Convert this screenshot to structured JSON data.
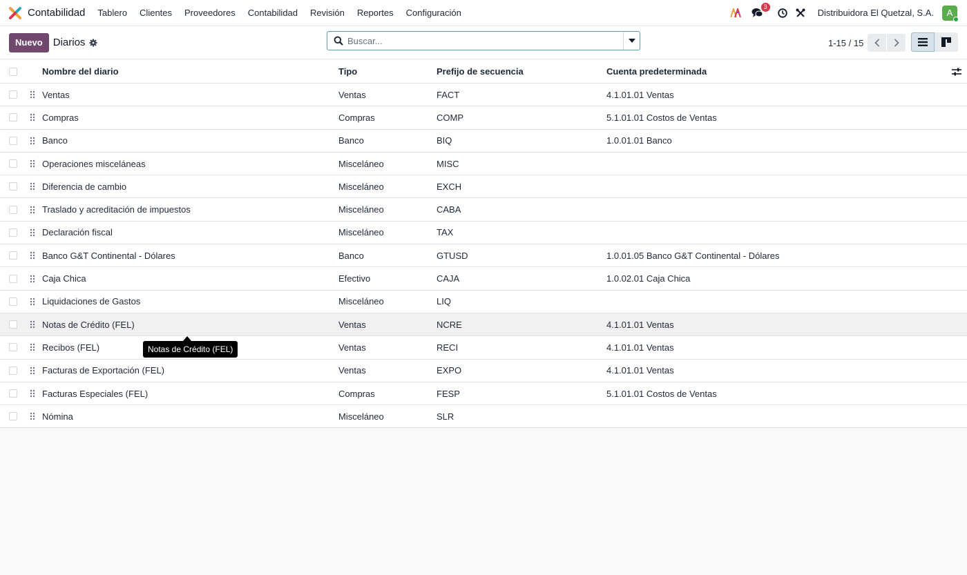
{
  "navbar": {
    "app_name": "Contabilidad",
    "menu": [
      "Tablero",
      "Clientes",
      "Proveedores",
      "Contabilidad",
      "Revisión",
      "Reportes",
      "Configuración"
    ],
    "messages_count": "3",
    "company": "Distribuidora El Quetzal, S.A.",
    "avatar_letter": "A",
    "icons": [
      "app-logo-icon",
      "ai-icon",
      "chat-icon",
      "clock-icon",
      "tools-icon"
    ]
  },
  "control_panel": {
    "new_label": "Nuevo",
    "title": "Diarios",
    "search_placeholder": "Buscar...",
    "pager": "1-15 / 15"
  },
  "table": {
    "columns": [
      "Nombre del diario",
      "Tipo",
      "Prefijo de secuencia",
      "Cuenta predeterminada"
    ],
    "rows": [
      {
        "name": "Ventas",
        "type": "Ventas",
        "prefix": "FACT",
        "account": "4.1.01.01 Ventas"
      },
      {
        "name": "Compras",
        "type": "Compras",
        "prefix": "COMP",
        "account": "5.1.01.01 Costos de Ventas"
      },
      {
        "name": "Banco",
        "type": "Banco",
        "prefix": "BIQ",
        "account": "1.0.01.01 Banco"
      },
      {
        "name": "Operaciones misceláneas",
        "type": "Misceláneo",
        "prefix": "MISC",
        "account": ""
      },
      {
        "name": "Diferencia de cambio",
        "type": "Misceláneo",
        "prefix": "EXCH",
        "account": ""
      },
      {
        "name": "Traslado y acreditación de impuestos",
        "type": "Misceláneo",
        "prefix": "CABA",
        "account": ""
      },
      {
        "name": "Declaración fiscal",
        "type": "Misceláneo",
        "prefix": "TAX",
        "account": ""
      },
      {
        "name": "Banco G&T Continental - Dólares",
        "type": "Banco",
        "prefix": "GTUSD",
        "account": "1.0.01.05 Banco G&T Continental - Dólares"
      },
      {
        "name": "Caja Chica",
        "type": "Efectivo",
        "prefix": "CAJA",
        "account": "1.0.02.01 Caja Chica"
      },
      {
        "name": "Liquidaciones de Gastos",
        "type": "Misceláneo",
        "prefix": "LIQ",
        "account": ""
      },
      {
        "name": "Notas de Crédito (FEL)",
        "type": "Ventas",
        "prefix": "NCRE",
        "account": "4.1.01.01 Ventas"
      },
      {
        "name": "Recibos (FEL)",
        "type": "Ventas",
        "prefix": "RECI",
        "account": "4.1.01.01 Ventas"
      },
      {
        "name": "Facturas de Exportación (FEL)",
        "type": "Ventas",
        "prefix": "EXPO",
        "account": "4.1.01.01 Ventas"
      },
      {
        "name": "Facturas Especiales (FEL)",
        "type": "Compras",
        "prefix": "FESP",
        "account": "5.1.01.01 Costos de Ventas"
      },
      {
        "name": "Nómina",
        "type": "Misceláneo",
        "prefix": "SLR",
        "account": ""
      }
    ]
  },
  "tooltip": {
    "text": "Notas de Crédito (FEL)"
  },
  "colors": {
    "primary": "#71476e",
    "badge": "#d9374b",
    "avatar": "#5cab4f"
  }
}
